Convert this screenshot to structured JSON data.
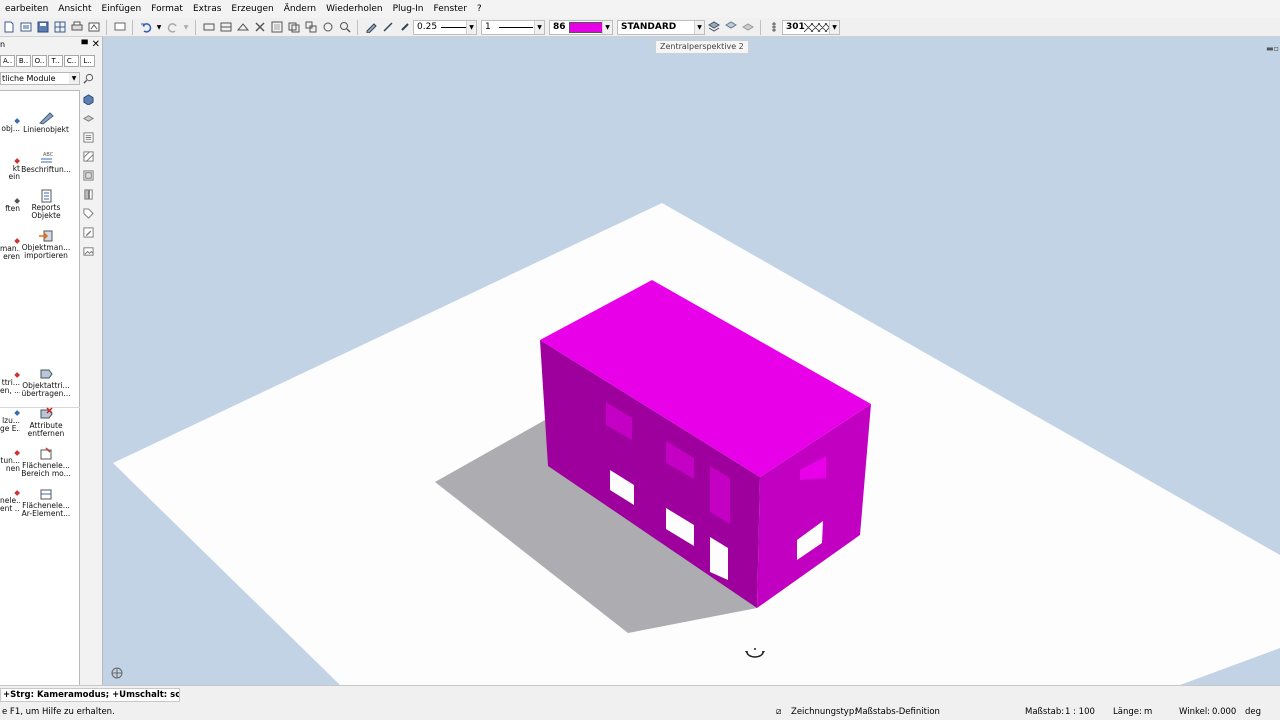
{
  "menu": [
    "earbeiten",
    "Ansicht",
    "Einfügen",
    "Format",
    "Extras",
    "Erzeugen",
    "Ändern",
    "Wiederholen",
    "Plug-In",
    "Fenster",
    "?"
  ],
  "toolbar": {
    "pen_value": "0.25",
    "line_value": "1",
    "color_value": "86",
    "color_hex": "#e600e6",
    "layer_value": "STANDARD",
    "pattern_value": "301"
  },
  "left_panel": {
    "tabs": [
      "A..",
      "B..",
      "O..",
      "T..",
      "C..",
      "L.."
    ],
    "module_select": "tliche Module",
    "items_right": [
      {
        "label": "Linienobjekt",
        "icon": "line-object-icon"
      },
      {
        "label": "Beschriftun...",
        "icon": "label-icon"
      },
      {
        "label": "Reports\nObjekte",
        "icon": "reports-icon"
      },
      {
        "label": "Objektman...\nimportieren",
        "icon": "import-icon"
      },
      {
        "label": "Objektattri...\nübertragen...",
        "icon": "attribute-transfer-icon"
      },
      {
        "label": "Attribute\nentfernen",
        "icon": "attribute-remove-icon"
      },
      {
        "label": "Flächenele...\nBereich mo...",
        "icon": "area-element-icon"
      },
      {
        "label": "Flächenele...\nAr-Element...",
        "icon": "area-element-2-icon"
      }
    ],
    "items_left_cut": [
      "obj...",
      "kt\nein",
      "ften",
      "man...\neren",
      "ttri...\nen, ...",
      "lzu...\nge E...",
      "tun...\nnen",
      "nele...\nent ..."
    ]
  },
  "viewport": {
    "label": "Zentralperspektive 2",
    "colors": {
      "background": "#c2d3e6",
      "ground": "#fdfdfd",
      "shadow": "#adadb1",
      "roof": "#e800e8",
      "front": "#9d009d",
      "side": "#c200c2"
    }
  },
  "status": {
    "command": "+Strg: Kameramodus; +Umschalt: schneller",
    "help": "e F1, um Hilfe zu erhalten.",
    "drawing_type_label": "Zeichnungstyp:",
    "drawing_type_value": "Maßstabs-Definition",
    "scale_label": "Maßstab:",
    "scale_value": "1 : 100",
    "length_label": "Länge:",
    "length_value": "m",
    "angle_label": "Winkel:",
    "angle_value": "0.000",
    "angle_unit": "deg"
  }
}
